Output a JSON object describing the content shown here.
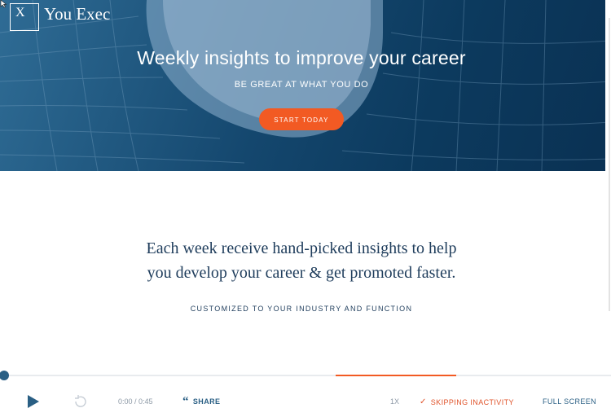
{
  "colors": {
    "accent": "#f25a23",
    "brand_blue": "#14476e",
    "text_navy": "#1f3d5c",
    "link_blue": "#2a5f84"
  },
  "header": {
    "logo_mark": "X",
    "brand": "You Exec"
  },
  "hero": {
    "title": "Weekly insights to improve your career",
    "subtitle": "BE GREAT AT WHAT YOU DO",
    "cta_label": "START TODAY"
  },
  "content": {
    "tagline_line1": "Each week receive hand-picked insights to help",
    "tagline_line2": "you develop your career & get promoted faster.",
    "subheading": "CUSTOMIZED TO YOUR INDUSTRY AND FUNCTION"
  },
  "player": {
    "progress": 0,
    "time": "0:00 / 0:45",
    "share_label": "SHARE",
    "speed": "1X",
    "skipping_label": "SKIPPING INACTIVITY",
    "fullscreen_label": "FULL SCREEN",
    "icons": {
      "play": "play-icon",
      "replay": "replay-icon",
      "share": "quote-icon",
      "skip": "check-icon"
    }
  }
}
